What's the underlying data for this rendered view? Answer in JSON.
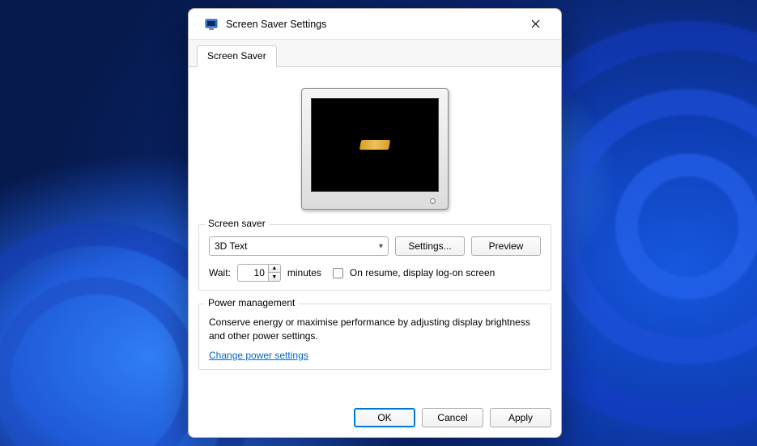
{
  "window": {
    "title": "Screen Saver Settings"
  },
  "tab": {
    "label": "Screen Saver"
  },
  "screensaver_group": {
    "title": "Screen saver",
    "selected": "3D Text",
    "settings_button": "Settings...",
    "preview_button": "Preview",
    "wait_label": "Wait:",
    "wait_value": "10",
    "wait_unit": "minutes",
    "resume_checkbox_label": "On resume, display log-on screen",
    "resume_checked": false
  },
  "power_group": {
    "title": "Power management",
    "description": "Conserve energy or maximise performance by adjusting display brightness and other power settings.",
    "link": "Change power settings"
  },
  "buttons": {
    "ok": "OK",
    "cancel": "Cancel",
    "apply": "Apply"
  }
}
